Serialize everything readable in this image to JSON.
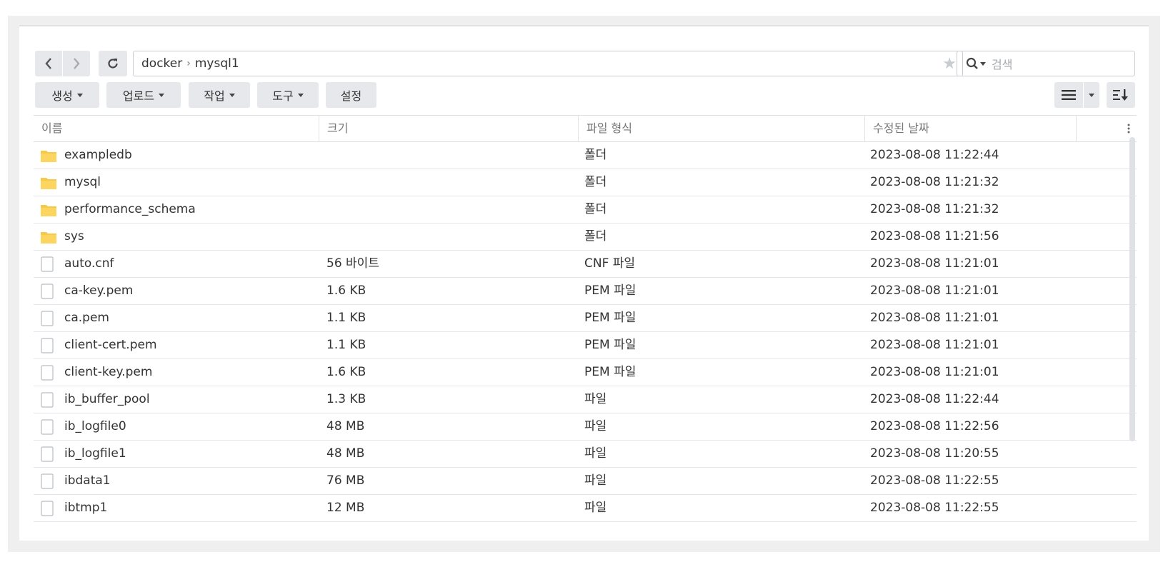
{
  "toolbar": {
    "path": [
      "docker",
      "mysql1"
    ],
    "path_separator": "›",
    "search_placeholder": "검색",
    "create_label": "생성",
    "upload_label": "업로드",
    "action_label": "작업",
    "tools_label": "도구",
    "settings_label": "설정"
  },
  "columns": {
    "name": "이름",
    "size": "크기",
    "type": "파일 형식",
    "modified": "수정된 날짜"
  },
  "files": [
    {
      "icon": "folder-icon",
      "name": "exampledb",
      "size": "",
      "type": "폴더",
      "modified": "2023-08-08 11:22:44"
    },
    {
      "icon": "folder-icon",
      "name": "mysql",
      "size": "",
      "type": "폴더",
      "modified": "2023-08-08 11:21:32"
    },
    {
      "icon": "folder-icon",
      "name": "performance_schema",
      "size": "",
      "type": "폴더",
      "modified": "2023-08-08 11:21:32"
    },
    {
      "icon": "folder-icon",
      "name": "sys",
      "size": "",
      "type": "폴더",
      "modified": "2023-08-08 11:21:56"
    },
    {
      "icon": "file-icon",
      "name": "auto.cnf",
      "size": "56 바이트",
      "type": "CNF 파일",
      "modified": "2023-08-08 11:21:01"
    },
    {
      "icon": "file-icon",
      "name": "ca-key.pem",
      "size": "1.6 KB",
      "type": "PEM 파일",
      "modified": "2023-08-08 11:21:01"
    },
    {
      "icon": "file-icon",
      "name": "ca.pem",
      "size": "1.1 KB",
      "type": "PEM 파일",
      "modified": "2023-08-08 11:21:01"
    },
    {
      "icon": "file-icon",
      "name": "client-cert.pem",
      "size": "1.1 KB",
      "type": "PEM 파일",
      "modified": "2023-08-08 11:21:01"
    },
    {
      "icon": "file-icon",
      "name": "client-key.pem",
      "size": "1.6 KB",
      "type": "PEM 파일",
      "modified": "2023-08-08 11:21:01"
    },
    {
      "icon": "file-icon",
      "name": "ib_buffer_pool",
      "size": "1.3 KB",
      "type": "파일",
      "modified": "2023-08-08 11:22:44"
    },
    {
      "icon": "file-icon",
      "name": "ib_logfile0",
      "size": "48 MB",
      "type": "파일",
      "modified": "2023-08-08 11:22:56"
    },
    {
      "icon": "file-icon",
      "name": "ib_logfile1",
      "size": "48 MB",
      "type": "파일",
      "modified": "2023-08-08 11:20:55"
    },
    {
      "icon": "file-icon",
      "name": "ibdata1",
      "size": "76 MB",
      "type": "파일",
      "modified": "2023-08-08 11:22:55"
    },
    {
      "icon": "file-icon",
      "name": "ibtmp1",
      "size": "12 MB",
      "type": "파일",
      "modified": "2023-08-08 11:22:55"
    }
  ],
  "colors": {
    "folder": "#f7c948",
    "button_bg": "#e6e8eb",
    "border": "#c9cdd2"
  }
}
